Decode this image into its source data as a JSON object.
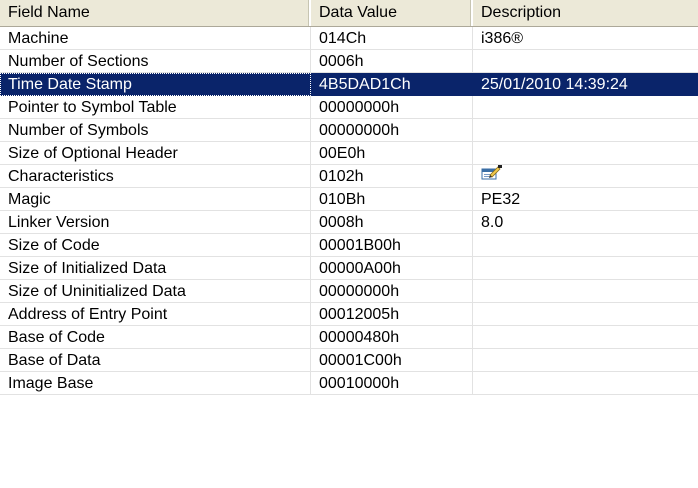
{
  "columns": {
    "field_name": "Field Name",
    "data_value": "Data Value",
    "description": "Description"
  },
  "rows": [
    {
      "field": "Machine",
      "value": "014Ch",
      "description": "i386®",
      "selected": false
    },
    {
      "field": "Number of Sections",
      "value": "0006h",
      "description": "",
      "selected": false
    },
    {
      "field": "Time Date Stamp",
      "value": "4B5DAD1Ch",
      "description": "25/01/2010 14:39:24",
      "selected": true
    },
    {
      "field": "Pointer to Symbol Table",
      "value": "00000000h",
      "description": "",
      "selected": false
    },
    {
      "field": "Number of Symbols",
      "value": "00000000h",
      "description": "",
      "selected": false
    },
    {
      "field": "Size of Optional Header",
      "value": "00E0h",
      "description": "",
      "selected": false
    },
    {
      "field": "Characteristics",
      "value": "0102h",
      "description": "",
      "icon": "edit-properties-icon",
      "selected": false
    },
    {
      "field": "Magic",
      "value": "010Bh",
      "description": "PE32",
      "selected": false
    },
    {
      "field": "Linker Version",
      "value": "0008h",
      "description": "8.0",
      "selected": false
    },
    {
      "field": "Size of Code",
      "value": "00001B00h",
      "description": "",
      "selected": false
    },
    {
      "field": "Size of Initialized Data",
      "value": "00000A00h",
      "description": "",
      "selected": false
    },
    {
      "field": "Size of Uninitialized Data",
      "value": "00000000h",
      "description": "",
      "selected": false
    },
    {
      "field": "Address of Entry Point",
      "value": "00012005h",
      "description": "",
      "selected": false
    },
    {
      "field": "Base of Code",
      "value": "00000480h",
      "description": "",
      "selected": false
    },
    {
      "field": "Base of Data",
      "value": "00001C00h",
      "description": "",
      "selected": false
    },
    {
      "field": "Image Base",
      "value": "00010000h",
      "description": "",
      "selected": false
    }
  ],
  "colors": {
    "selection_background": "#0a246a",
    "header_background": "#ece9d8"
  }
}
